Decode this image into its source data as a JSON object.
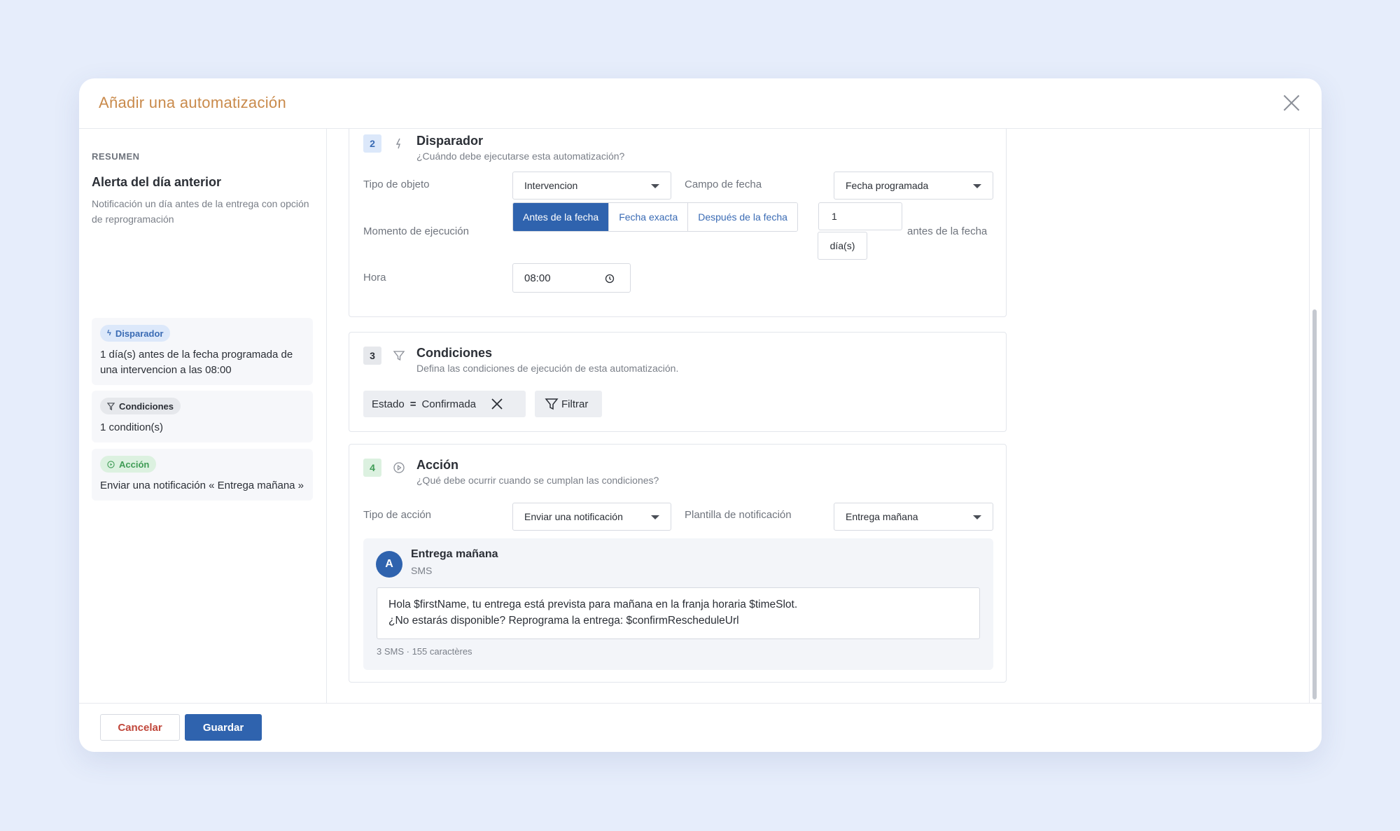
{
  "modal": {
    "title": "Añadir una automatización"
  },
  "sidebar": {
    "section_label": "RESUMEN",
    "title": "Alerta del día anterior",
    "description": "Notificación un día antes de la entrega con opción de reprogramación",
    "cards": [
      {
        "pill": "Disparador",
        "icon": "bolt-icon",
        "text": "1 día(s) antes de la fecha programada de una intervencion a las 08:00"
      },
      {
        "pill": "Condiciones",
        "icon": "filter-icon",
        "text": "1 condition(s)"
      },
      {
        "pill": "Acción",
        "icon": "play-icon",
        "text": "Enviar una notificación « Entrega mañana »"
      }
    ]
  },
  "trigger": {
    "number": "2",
    "title": "Disparador",
    "subtitle": "¿Cuándo debe ejecutarse esta automatización?",
    "object_type_label": "Tipo de objeto",
    "object_type_value": "Intervencion",
    "date_field_label": "Campo de fecha",
    "date_field_value": "Fecha programada",
    "timing_label": "Momento de ejecución",
    "timing_options": [
      "Antes de la fecha",
      "Fecha exacta",
      "Después de la fecha"
    ],
    "offset_value": "1",
    "offset_unit": "día(s)",
    "offset_suffix": "antes de la fecha",
    "time_label": "Hora",
    "time_value": "08:00"
  },
  "conditions": {
    "number": "3",
    "title": "Condiciones",
    "subtitle": "Defina las condiciones de ejecución de esta automatización.",
    "chip_field": "Estado",
    "chip_operator": "=",
    "chip_value": "Confirmada",
    "filter_label": "Filtrar"
  },
  "action": {
    "number": "4",
    "title": "Acción",
    "subtitle": "¿Qué debe ocurrir cuando se cumplan las condiciones?",
    "action_type_label": "Tipo de acción",
    "action_type_value": "Enviar una notificación",
    "template_label": "Plantilla de notificación",
    "template_value": "Entrega mañana",
    "preview": {
      "avatar": "A",
      "name": "Entrega mañana",
      "channel": "SMS",
      "message_line1": "Hola $firstName, tu entrega está prevista para mañana en la franja horaria $timeSlot.",
      "message_line2": "¿No estarás disponible? Reprograma la entrega: $confirmRescheduleUrl",
      "meta": "3 SMS · 155 caractères"
    }
  },
  "footer": {
    "cancel_label": "Cancelar",
    "save_label": "Guardar"
  },
  "colors": {
    "accent": "#2f63ae",
    "title_orange": "#c98a4b",
    "cancel_red": "#c0463a",
    "background": "#e6edfb"
  }
}
